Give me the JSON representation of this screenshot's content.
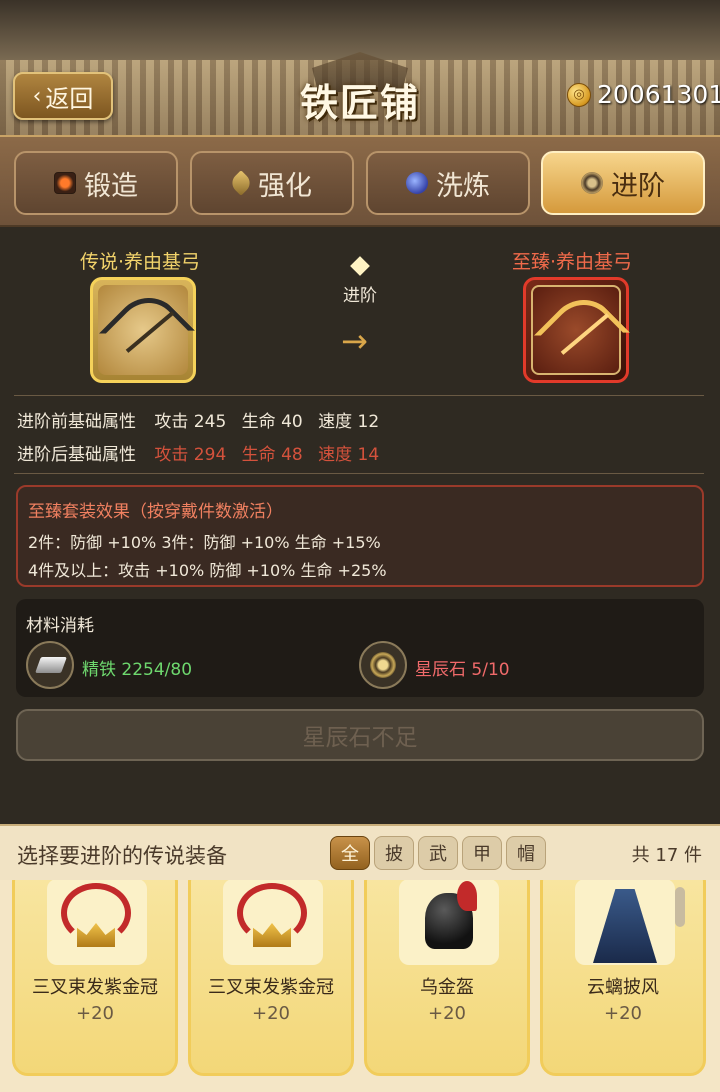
{
  "header": {
    "back_label": "返回",
    "title": "铁匠铺",
    "coins": "20061301"
  },
  "tabs": [
    {
      "label": "锻造",
      "icon": "forge-icon",
      "active": false
    },
    {
      "label": "强化",
      "icon": "enhance-icon",
      "active": false
    },
    {
      "label": "洗炼",
      "icon": "refine-icon",
      "active": false
    },
    {
      "label": "进阶",
      "icon": "advance-icon",
      "active": true
    }
  ],
  "advance": {
    "from_name": "传说·养由基弓",
    "to_name": "至臻·养由基弓",
    "arrow_label": "进阶",
    "arrow_glyph": "→"
  },
  "stats": {
    "before_label": "进阶前基础属性",
    "after_label": "进阶后基础属性",
    "before": [
      "攻击 245",
      "生命 40",
      "速度 12"
    ],
    "after": [
      "攻击 294",
      "生命 48",
      "速度 14"
    ]
  },
  "set_bonus": {
    "title": "至臻套装效果（按穿戴件数激活）",
    "line1": "2件：防御 +10%    3件：防御 +10%  生命 +15%",
    "line2": "4件及以上：攻击 +10%  防御 +10%  生命 +25%"
  },
  "materials": {
    "title": "材料消耗",
    "items": [
      {
        "name": "精铁",
        "amount": "2254/80",
        "sufficient": true,
        "icon": "iron-ingot-icon"
      },
      {
        "name": "星辰石",
        "amount": "5/10",
        "sufficient": false,
        "icon": "star-stone-icon"
      }
    ]
  },
  "action_button": "星辰石不足",
  "selection": {
    "title": "选择要进阶的传说装备",
    "filters": [
      "全",
      "披",
      "武",
      "甲",
      "帽"
    ],
    "count": "共 17 件",
    "items": [
      {
        "name": "三叉束发紫金冠",
        "level": "+20",
        "icon": "crown-icon"
      },
      {
        "name": "三叉束发紫金冠",
        "level": "+20",
        "icon": "crown-icon"
      },
      {
        "name": "乌金盔",
        "level": "+20",
        "icon": "helmet-icon"
      },
      {
        "name": "云螭披风",
        "level": "+20",
        "icon": "cape-icon"
      }
    ]
  },
  "colors": {
    "legend_gold": "#f2d36b",
    "supreme_red": "#f06a4a",
    "ok_green": "#6ed86e",
    "bad_red": "#f06a6a"
  }
}
